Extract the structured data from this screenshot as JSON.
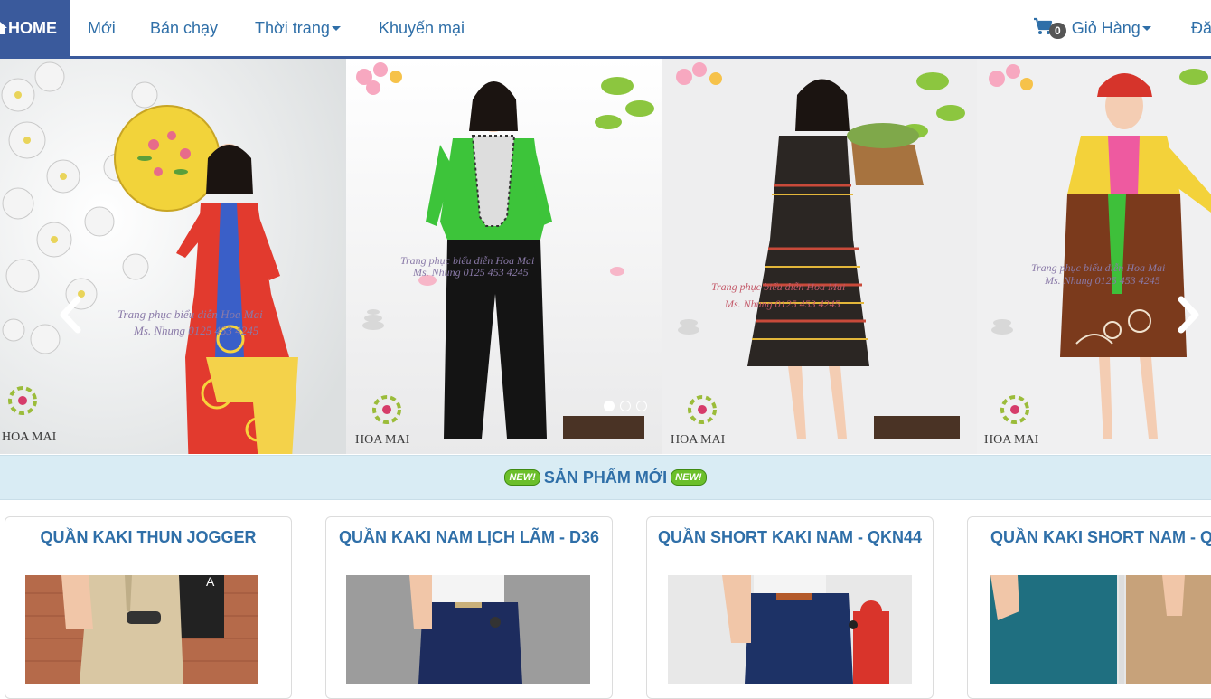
{
  "nav": {
    "home_label": "HOME",
    "items": [
      {
        "label": "Mới"
      },
      {
        "label": "Bán chạy"
      },
      {
        "label": "Thời trang",
        "has_dropdown": true
      },
      {
        "label": "Khuyến mại"
      }
    ],
    "cart": {
      "count": "0",
      "label": "Giỏ Hàng"
    },
    "login_label": "Đă"
  },
  "carousel": {
    "watermark": {
      "line1": "Trang phục biểu diễn Hoa Mai",
      "line2": "Ms. Nhung 0125 453 4245",
      "brand": "HOA MAI"
    },
    "slide_count": 3,
    "active_slide": 1
  },
  "section": {
    "badge": "NEW!",
    "title": "SẢN PHẨM MỚI"
  },
  "products": [
    {
      "name": "QUẦN KAKI THUN JOGGER"
    },
    {
      "name": "QUẦN KAKI NAM LỊCH LÃM - D36"
    },
    {
      "name": "QUẦN SHORT KAKI NAM - QKN44"
    },
    {
      "name": "QUẦN KAKI SHORT NAM - QS"
    }
  ],
  "colors": {
    "brand": "#3a5a9c",
    "link": "#2f6fa8",
    "section_bg": "#d9ecf4",
    "new_badge": "#6bbf2a"
  }
}
